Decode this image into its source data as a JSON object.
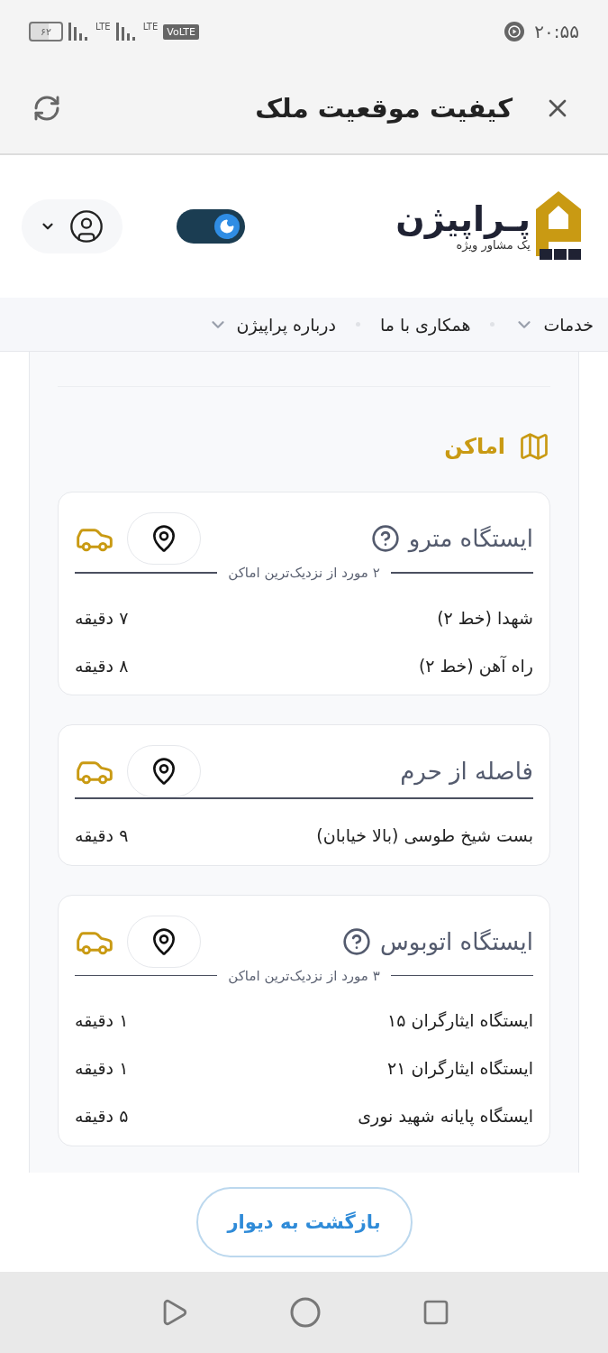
{
  "status_bar": {
    "time": "۲۰:۵۵",
    "battery": "۶۲",
    "network_labels": [
      "LTE",
      "LTE"
    ],
    "volte": "VoLTE"
  },
  "header": {
    "title": "کیفیت موقعیت ملک"
  },
  "site": {
    "logo_name": "پـراپیژن",
    "logo_tagline": "یک مشاور ویژه",
    "dark_mode": {
      "on": true
    }
  },
  "nav": [
    {
      "label": "خدمات",
      "has_menu": true
    },
    {
      "label": "همکاری با ما",
      "has_menu": false
    },
    {
      "label": "درباره پراپیژن",
      "has_menu": true
    }
  ],
  "section": {
    "title": "اماکن"
  },
  "cards": [
    {
      "title": "ایستگاه مترو",
      "has_help": true,
      "summary": "۲ مورد از نزدیک‌ترین اماکن",
      "places": [
        {
          "name": "شهدا (خط ۲)",
          "time": "۷ دقیقه"
        },
        {
          "name": "راه آهن (خط ۲)",
          "time": "۸ دقیقه"
        }
      ]
    },
    {
      "title": "فاصله از حرم",
      "has_help": false,
      "places": [
        {
          "name": "بست شیخ طوسی (بالا خیابان)",
          "time": "۹ دقیقه"
        }
      ]
    },
    {
      "title": "ایستگاه اتوبوس",
      "has_help": true,
      "summary": "۳ مورد از نزدیک‌ترین اماکن",
      "places": [
        {
          "name": "ایستگاه ایثارگران ۱۵",
          "time": "۱ دقیقه"
        },
        {
          "name": "ایستگاه ایثارگران ۲۱",
          "time": "۱ دقیقه"
        },
        {
          "name": "ایستگاه پایانه شهید نوری",
          "time": "۵ دقیقه"
        }
      ]
    }
  ],
  "back_button": "بازگشت به دیوار"
}
